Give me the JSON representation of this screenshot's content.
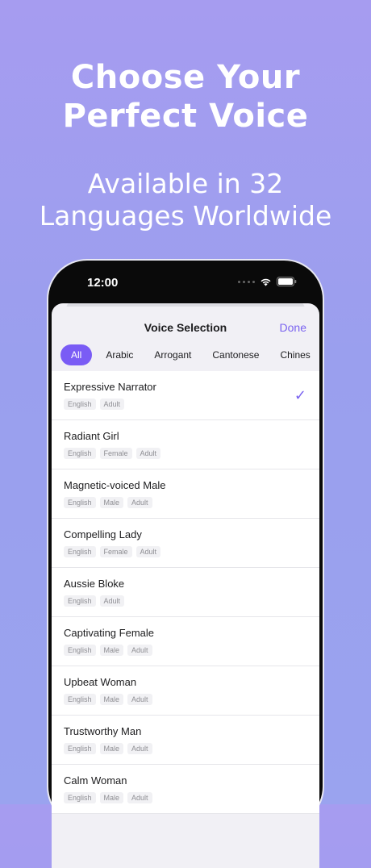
{
  "hero": {
    "headline_line1": "Choose Your",
    "headline_line2": "Perfect Voice",
    "sub_line1": "Available in 32",
    "sub_line2": "Languages Worldwide"
  },
  "status_bar": {
    "time": "12:00"
  },
  "sheet": {
    "title": "Voice Selection",
    "done_label": "Done"
  },
  "filters": [
    "All",
    "Arabic",
    "Arrogant",
    "Cantonese",
    "Chines"
  ],
  "selected_filter": "All",
  "voices": [
    {
      "name": "Expressive Narrator",
      "tags": [
        "English",
        "Adult"
      ],
      "selected": true
    },
    {
      "name": "Radiant Girl",
      "tags": [
        "English",
        "Female",
        "Adult"
      ],
      "selected": false
    },
    {
      "name": "Magnetic-voiced Male",
      "tags": [
        "English",
        "Male",
        "Adult"
      ],
      "selected": false
    },
    {
      "name": "Compelling Lady",
      "tags": [
        "English",
        "Female",
        "Adult"
      ],
      "selected": false
    },
    {
      "name": "Aussie Bloke",
      "tags": [
        "English",
        "Adult"
      ],
      "selected": false
    },
    {
      "name": "Captivating Female",
      "tags": [
        "English",
        "Male",
        "Adult"
      ],
      "selected": false
    },
    {
      "name": "Upbeat Woman",
      "tags": [
        "English",
        "Male",
        "Adult"
      ],
      "selected": false
    },
    {
      "name": "Trustworthy Man",
      "tags": [
        "English",
        "Male",
        "Adult"
      ],
      "selected": false
    },
    {
      "name": "Calm Woman",
      "tags": [
        "English",
        "Male",
        "Adult"
      ],
      "selected": false
    }
  ],
  "icons": {
    "check": "checkmark-icon",
    "wifi": "wifi-icon",
    "battery": "battery-icon",
    "signal": "signal-dots-icon"
  },
  "colors": {
    "accent": "#7a63f0",
    "chip_active": "#7a5cf5"
  }
}
